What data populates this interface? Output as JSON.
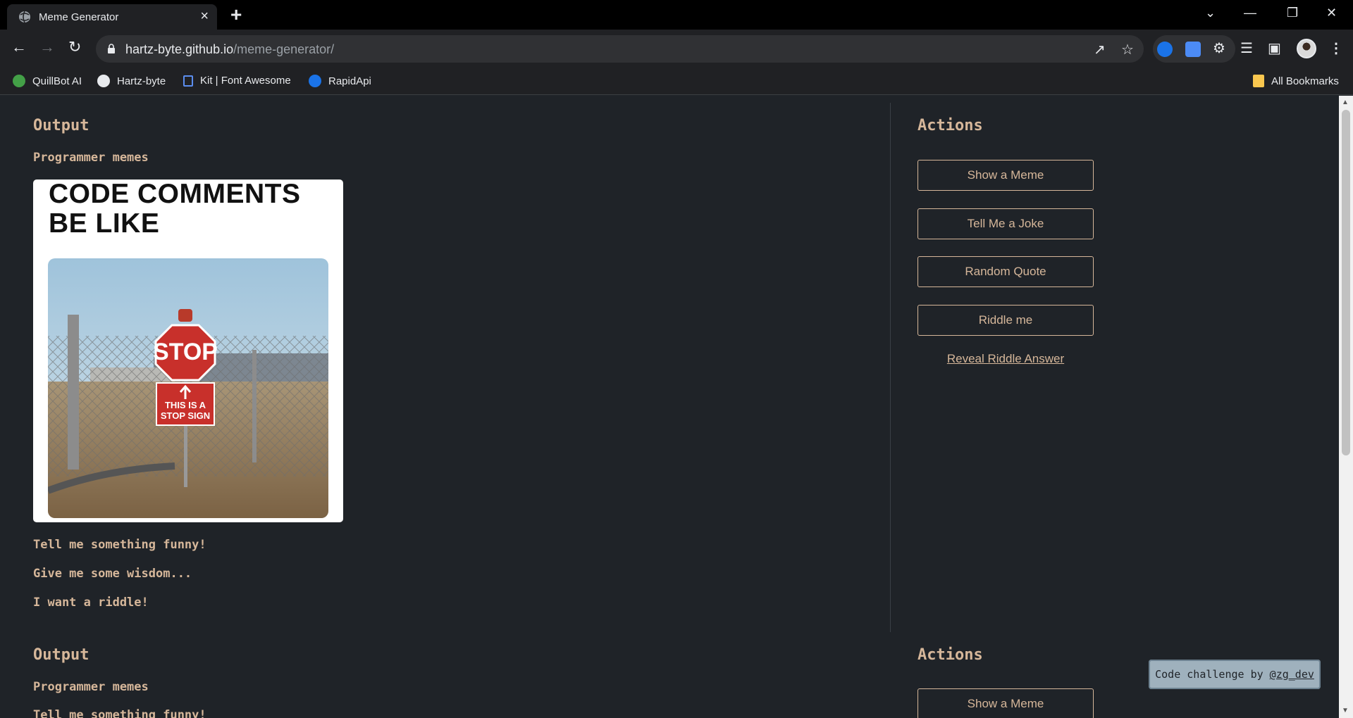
{
  "browser": {
    "tab_title": "Meme Generator",
    "new_tab_symbol": "+",
    "close_symbol": "×",
    "url_host": "hartz-byte.github.io",
    "url_path": "/meme-generator/",
    "bookmarks": [
      "QuillBot AI",
      "Hartz-byte",
      "Kit | Font Awesome",
      "RapidApi"
    ],
    "all_bookmarks": "All Bookmarks"
  },
  "page": {
    "output_heading": "Output",
    "category": "Programmer memes",
    "meme_caption": "CODE COMMENTS\nBE LIKE",
    "sign_stop": "STOP",
    "sign_note_1": "THIS IS A",
    "sign_note_2": "STOP SIGN",
    "joke_prompt": "Tell me something funny!",
    "quote_prompt": "Give me some wisdom...",
    "riddle_prompt": "I want a riddle!",
    "output_heading_2": "Output",
    "category_2": "Programmer memes",
    "joke_prompt_2": "Tell me something funny!"
  },
  "actions": {
    "heading": "Actions",
    "show_meme": "Show a Meme",
    "tell_joke": "Tell Me a Joke",
    "random_quote": "Random Quote",
    "riddle_me": "Riddle me",
    "reveal_answer": "Reveal Riddle Answer",
    "heading_2": "Actions",
    "show_meme_2": "Show a Meme"
  },
  "badge": {
    "text": "Code challenge by ",
    "link": "@zg_dev"
  }
}
